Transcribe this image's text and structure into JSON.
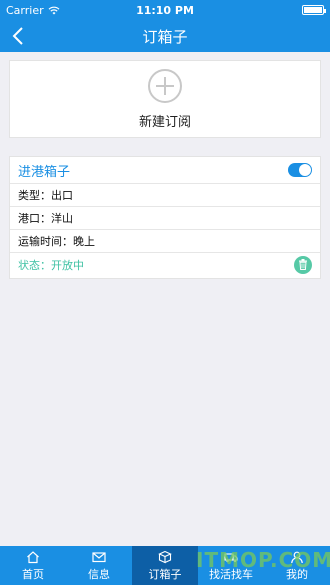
{
  "status_bar": {
    "carrier": "Carrier",
    "time": "11:10 PM"
  },
  "nav": {
    "title": "订箱子"
  },
  "new_subscription": {
    "label": "新建订阅"
  },
  "subscription": {
    "name": "进港箱子",
    "enabled": true,
    "type": "类型：出口",
    "port": "港口：洋山",
    "transport_time": "运输时间：晚上",
    "status": "状态：开放中"
  },
  "tabs": [
    {
      "label": "首页",
      "icon": "home-icon"
    },
    {
      "label": "信息",
      "icon": "mail-icon"
    },
    {
      "label": "订箱子",
      "icon": "box-icon",
      "active": true
    },
    {
      "label": "找活找车",
      "icon": "truck-icon"
    },
    {
      "label": "我的",
      "icon": "user-icon"
    }
  ],
  "watermark": "ITMOP.COM",
  "colors": {
    "primary": "#1a8fe3",
    "active_tab": "#0d5fa6",
    "status_green": "#3ec1a3"
  }
}
